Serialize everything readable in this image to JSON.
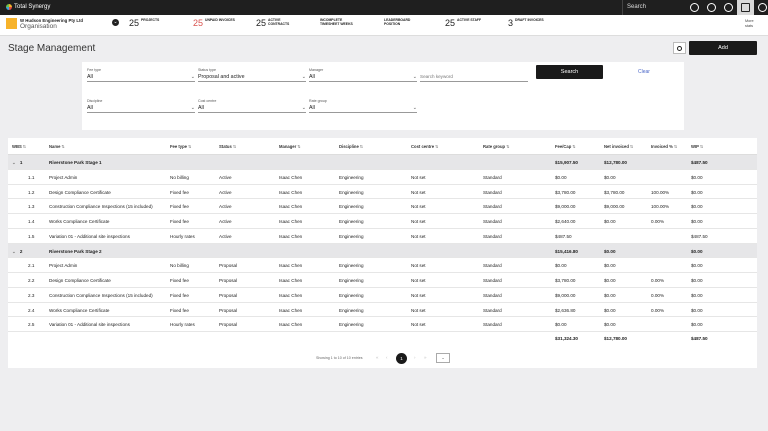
{
  "app": {
    "name": "Total Synergy",
    "search_label": "Search"
  },
  "top_icons": [
    "location-icon",
    "plus-circle-icon",
    "timer-icon",
    "calendar-icon",
    "account-icon"
  ],
  "org": {
    "name": "W Hudson Engineering Pty Ltd",
    "sub": "Organisation"
  },
  "stats": [
    {
      "num": "25",
      "label": "PROJECTS",
      "red": false
    },
    {
      "num": "25",
      "label": "UNPAID INVOICES",
      "red": true
    },
    {
      "num": "25",
      "label": "ACTIVE CONTRACTS",
      "red": false
    },
    {
      "num": "",
      "label": "INCOMPLETE TIMESHEET WEEKS",
      "red": false
    },
    {
      "num": "",
      "label": "LEADERBOARD POSITION",
      "red": false
    },
    {
      "num": "25",
      "label": "ACTIVE STAFF",
      "red": false
    },
    {
      "num": "3",
      "label": "DRAFT INVOICES",
      "red": false
    }
  ],
  "more_stats": "More stats",
  "page": {
    "title": "Stage Management",
    "add_label": "Add"
  },
  "filters": {
    "fee_type": {
      "label": "Fee type",
      "value": "All"
    },
    "status_type": {
      "label": "Status type",
      "value": "Proposal and active"
    },
    "manager": {
      "label": "Manager",
      "value": "All"
    },
    "keyword_placeholder": "Search keyword",
    "discipline": {
      "label": "Discipline",
      "value": "All"
    },
    "cost_centre": {
      "label": "Cost centre",
      "value": "All"
    },
    "rate_group": {
      "label": "Rate group",
      "value": "All"
    },
    "search_label": "Search",
    "clear_label": "Clear"
  },
  "table": {
    "headers": [
      "WBS",
      "Name",
      "Fee type",
      "Status",
      "Manager",
      "Discipline",
      "Cost centre",
      "Rate group",
      "Fee/Cap",
      "Net invoiced",
      "Invoiced %",
      "WIP"
    ],
    "rows": [
      {
        "group": true,
        "wbs": "1",
        "name": "Riverstone Park Stage 1",
        "fee": "",
        "status": "",
        "manager": "",
        "discipline": "",
        "cost": "",
        "rate": "",
        "feecap": "$15,907.50",
        "net": "$12,780.00",
        "pct": "",
        "wip": "$487.50"
      },
      {
        "group": false,
        "wbs": "1.1",
        "name": "Project Admin",
        "fee": "No billing",
        "status": "Active",
        "manager": "Isaac Chen",
        "discipline": "Engineering",
        "cost": "Not set",
        "rate": "Standard",
        "feecap": "$0.00",
        "net": "$0.00",
        "pct": "",
        "wip": "$0.00"
      },
      {
        "group": false,
        "wbs": "1.2",
        "name": "Design Compliance Certificate",
        "fee": "Fixed fee",
        "status": "Active",
        "manager": "Isaac Chen",
        "discipline": "Engineering",
        "cost": "Not set",
        "rate": "Standard",
        "feecap": "$3,780.00",
        "net": "$3,780.00",
        "pct": "100.00%",
        "wip": "$0.00"
      },
      {
        "group": false,
        "wbs": "1.3",
        "name": "Construction Compliance Inspections (15 included)",
        "fee": "Fixed fee",
        "status": "Active",
        "manager": "Isaac Chen",
        "discipline": "Engineering",
        "cost": "Not set",
        "rate": "Standard",
        "feecap": "$9,000.00",
        "net": "$9,000.00",
        "pct": "100.00%",
        "wip": "$0.00"
      },
      {
        "group": false,
        "wbs": "1.4",
        "name": "Works Compliance Certificate",
        "fee": "Fixed fee",
        "status": "Active",
        "manager": "Isaac Chen",
        "discipline": "Engineering",
        "cost": "Not set",
        "rate": "Standard",
        "feecap": "$2,640.00",
        "net": "$0.00",
        "pct": "0.00%",
        "wip": "$0.00"
      },
      {
        "group": false,
        "wbs": "1.5",
        "name": "Variation 01 - Additional site inspections",
        "fee": "Hourly rates",
        "status": "Active",
        "manager": "Isaac Chen",
        "discipline": "Engineering",
        "cost": "Not set",
        "rate": "Standard",
        "feecap": "$487.50",
        "net": "",
        "pct": "",
        "wip": "$487.50"
      },
      {
        "group": true,
        "wbs": "2",
        "name": "Riverstone Park Stage 2",
        "fee": "",
        "status": "",
        "manager": "",
        "discipline": "",
        "cost": "",
        "rate": "",
        "feecap": "$15,416.80",
        "net": "$0.00",
        "pct": "",
        "wip": "$0.00"
      },
      {
        "group": false,
        "wbs": "2.1",
        "name": "Project Admin",
        "fee": "No billing",
        "status": "Proposal",
        "manager": "Isaac Chen",
        "discipline": "Engineering",
        "cost": "Not set",
        "rate": "Standard",
        "feecap": "$0.00",
        "net": "$0.00",
        "pct": "",
        "wip": "$0.00"
      },
      {
        "group": false,
        "wbs": "2.2",
        "name": "Design Compliance Certificate",
        "fee": "Fixed fee",
        "status": "Proposal",
        "manager": "Isaac Chen",
        "discipline": "Engineering",
        "cost": "Not set",
        "rate": "Standard",
        "feecap": "$3,780.00",
        "net": "$0.00",
        "pct": "0.00%",
        "wip": "$0.00"
      },
      {
        "group": false,
        "wbs": "2.3",
        "name": "Construction Compliance Inspections (15 included)",
        "fee": "Fixed fee",
        "status": "Proposal",
        "manager": "Isaac Chen",
        "discipline": "Engineering",
        "cost": "Not set",
        "rate": "Standard",
        "feecap": "$9,000.00",
        "net": "$0.00",
        "pct": "0.00%",
        "wip": "$0.00"
      },
      {
        "group": false,
        "wbs": "2.4",
        "name": "Works Compliance Certificate",
        "fee": "Fixed fee",
        "status": "Proposal",
        "manager": "Isaac Chen",
        "discipline": "Engineering",
        "cost": "Not set",
        "rate": "Standard",
        "feecap": "$2,636.80",
        "net": "$0.00",
        "pct": "0.00%",
        "wip": "$0.00"
      },
      {
        "group": false,
        "wbs": "2.5",
        "name": "Variation 01 - Additional site inspections",
        "fee": "Hourly rates",
        "status": "Proposal",
        "manager": "Isaac Chen",
        "discipline": "Engineering",
        "cost": "Not set",
        "rate": "Standard",
        "feecap": "$0.00",
        "net": "$0.00",
        "pct": "",
        "wip": "$0.00"
      }
    ],
    "totals": {
      "feecap": "$31,324.30",
      "net": "$12,780.00",
      "wip": "$487.50"
    }
  },
  "pagination": {
    "summary": "Showing 1 to 10 of 10 entries",
    "first": "«",
    "prev": "‹",
    "current": "1",
    "next": "›",
    "last": "»",
    "size_toggle": "⌄"
  }
}
